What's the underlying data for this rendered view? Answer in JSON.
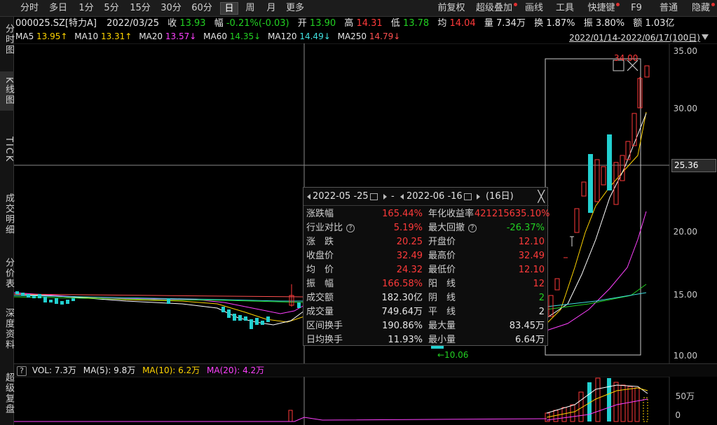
{
  "toolbar": {
    "left": [
      "分时",
      "多日",
      "1分",
      "5分",
      "15分",
      "30分",
      "60分",
      "日",
      "周",
      "月",
      "更多"
    ],
    "right": [
      "前复权",
      "超级叠加",
      "画线",
      "工具",
      "快捷键",
      "F9",
      "普通",
      "隐藏"
    ]
  },
  "left_tabs": [
    "分时图",
    "K线图",
    "TICK",
    "成交明细",
    "分价表",
    "深度资料",
    "超级复盘"
  ],
  "info": {
    "code": "000025.SZ[特力A]",
    "date": "2022/03/25",
    "close_label": "收",
    "close": "13.93",
    "chg_label": "幅",
    "chg": "-0.21%(-0.03)",
    "open_label": "开",
    "open": "13.90",
    "high_label": "高",
    "high": "14.31",
    "low_label": "低",
    "low": "13.78",
    "avg_label": "均",
    "avg": "14.04",
    "vol_label": "量",
    "vol": "7.34万",
    "turn_label": "换",
    "turn": "1.87%",
    "amp_label": "振",
    "amp": "3.80%",
    "amt_label": "额",
    "amt": "1.03亿"
  },
  "ma": {
    "ma5": "MA5",
    "ma5_v": "13.95↑",
    "ma10": "MA10",
    "ma10_v": "13.31↑",
    "ma20": "MA20",
    "ma20_v": "13.57↓",
    "ma60": "MA60",
    "ma60_v": "14.35↓",
    "ma120": "MA120",
    "ma120_v": "14.49↓",
    "ma250": "MA250",
    "ma250_v": "14.79↓"
  },
  "range_text": "2022/01/14-2022/06/17(100日)",
  "y_axis": [
    "35.00",
    "30.00",
    "20.00",
    "15.00",
    "10.00"
  ],
  "crosshair_price": "25.36",
  "high_mark": "34.00",
  "low_mark": "←10.06",
  "vol_axis": [
    "50万",
    "0"
  ],
  "volume": {
    "q": "?",
    "vol": "VOL: 7.3万",
    "ma5": "MA(5): 9.8万",
    "ma10": "MA(10): 6.2万",
    "ma20": "MA(20): 4.2万"
  },
  "popup": {
    "start": "2022-05 -25",
    "sep": "-",
    "end": "2022-06 -16",
    "days": "(16日)",
    "close": "╳",
    "rows_left": [
      {
        "label": "涨跌幅",
        "value": "165.44%",
        "color": "red"
      },
      {
        "label": "行业对比",
        "value": "5.19%",
        "color": "red"
      },
      {
        "label": "涨　跌",
        "value": "20.25",
        "color": "red"
      },
      {
        "label": "收盘价",
        "value": "32.49",
        "color": "red"
      },
      {
        "label": "均　价",
        "value": "24.32",
        "color": "red"
      },
      {
        "label": "振　幅",
        "value": "166.58%",
        "color": "red"
      },
      {
        "label": "成交额",
        "value": "182.30亿",
        "color": "white"
      },
      {
        "label": "成交量",
        "value": "749.64万",
        "color": "white"
      },
      {
        "label": "区间换手",
        "value": "190.86%",
        "color": "white"
      },
      {
        "label": "日均换手",
        "value": "11.93%",
        "color": "white"
      }
    ],
    "rows_right": [
      {
        "label": "年化收益率",
        "value": "421215635.10%",
        "color": "red"
      },
      {
        "label": "最大回撤",
        "value": "-26.37%",
        "color": "green"
      },
      {
        "label": "开盘价",
        "value": "12.10",
        "color": "red"
      },
      {
        "label": "最高价",
        "value": "32.49",
        "color": "red"
      },
      {
        "label": "最低价",
        "value": "12.10",
        "color": "red"
      },
      {
        "label": "阳　线",
        "value": "12",
        "color": "red"
      },
      {
        "label": "阴　线",
        "value": "2",
        "color": "green"
      },
      {
        "label": "平　线",
        "value": "2",
        "color": "white"
      },
      {
        "label": "最大量",
        "value": "83.45万",
        "color": "white"
      },
      {
        "label": "最小量",
        "value": "6.64万",
        "color": "white"
      }
    ],
    "qmark": "?"
  },
  "colors": {
    "up": "#ff3a3a",
    "down": "#22d0d0",
    "ma5": "#ffffff",
    "ma10": "#ffd400",
    "ma20": "#ff40ff",
    "ma60": "#22d022",
    "ma120": "#40e0e0",
    "ma250": "#ff5050"
  }
}
